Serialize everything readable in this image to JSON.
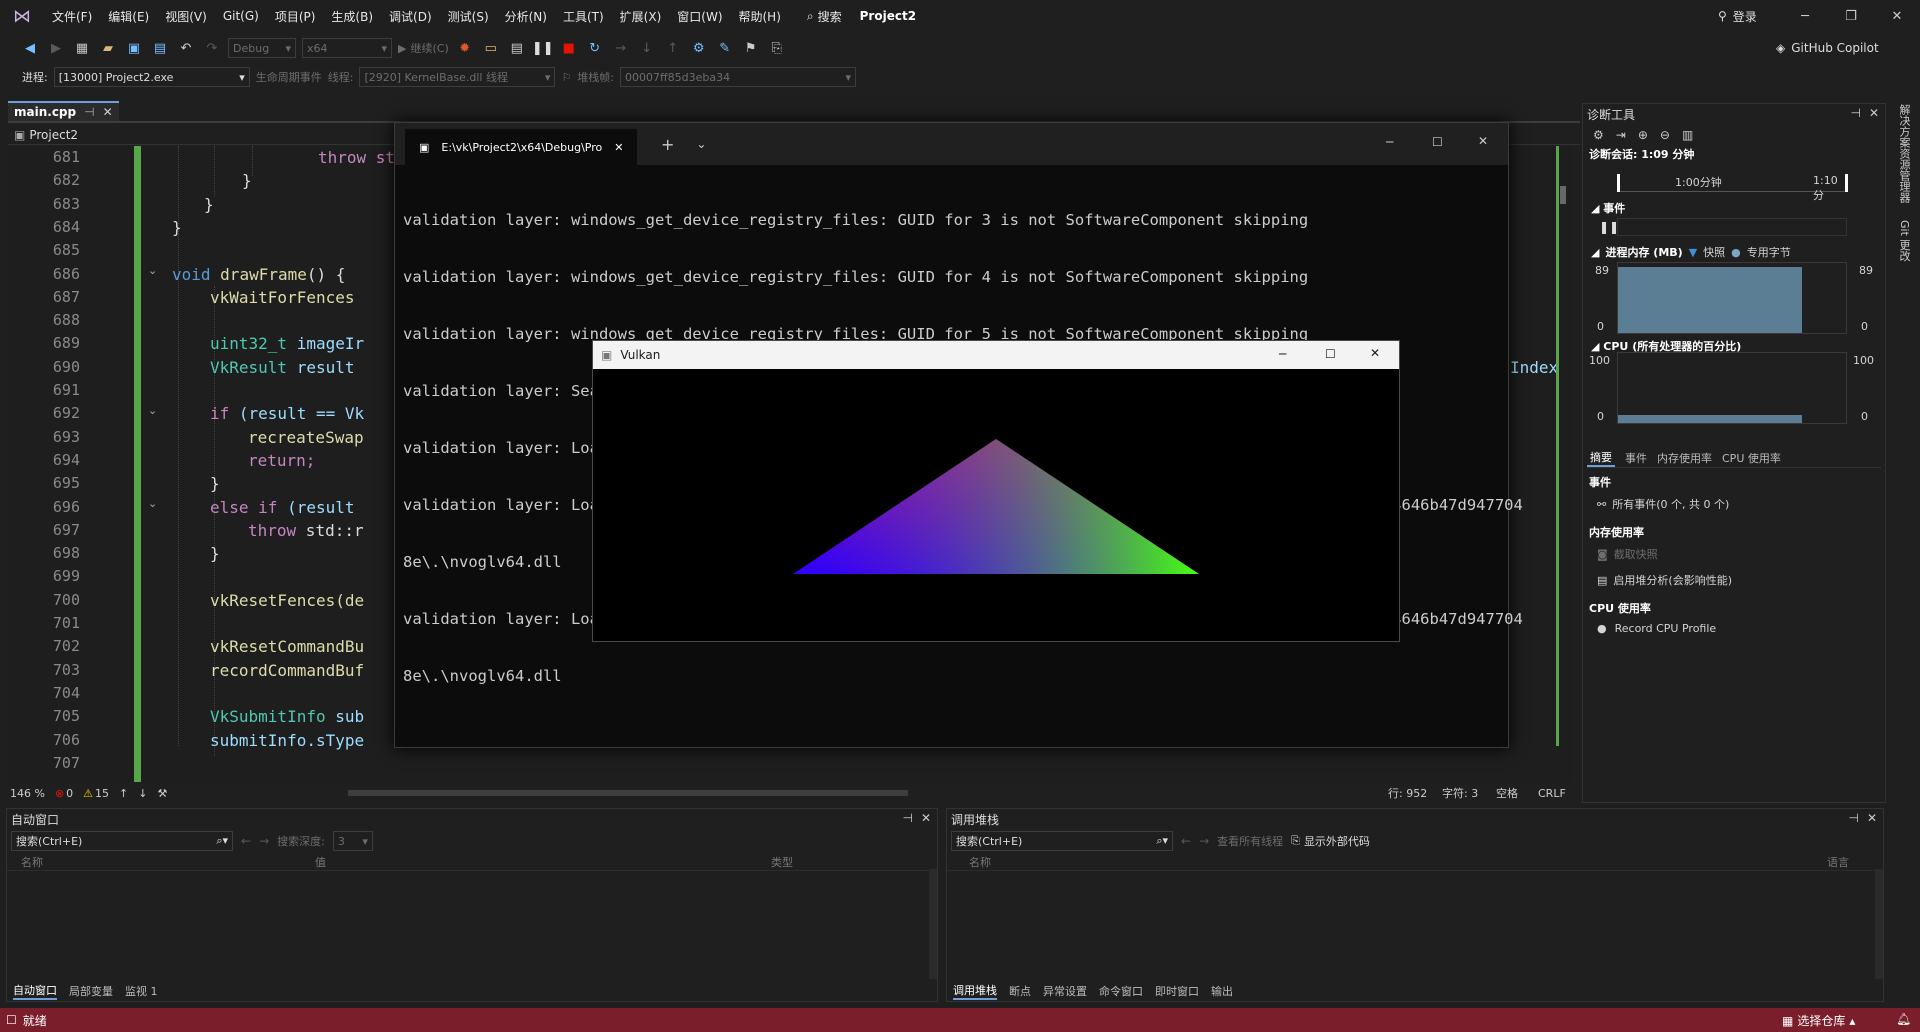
{
  "menu": {
    "items": [
      "文件(F)",
      "编辑(E)",
      "视图(V)",
      "Git(G)",
      "项目(P)",
      "生成(B)",
      "调试(D)",
      "测试(S)",
      "分析(N)",
      "工具(T)",
      "扩展(X)",
      "窗口(W)",
      "帮助(H)"
    ],
    "search": "搜索",
    "project_title": "Project2",
    "login": "登录",
    "copilot": "GitHub Copilot"
  },
  "toolbar": {
    "config": "Debug",
    "platform": "x64",
    "continue": "继续(C)"
  },
  "debugbar": {
    "process_label": "进程:",
    "process_value": "[13000] Project2.exe",
    "lifecycle": "生命周期事件",
    "thread_label": "线程:",
    "thread_value": "[2920] KernelBase.dll 线程",
    "stack_label": "堆栈帧:",
    "stack_value": "00007ff85d3eba34"
  },
  "editor": {
    "tab": "main.cpp",
    "nav_project": "Project2",
    "line_numbers": [
      "681",
      "682",
      "683",
      "684",
      "685",
      "686",
      "687",
      "688",
      "689",
      "690",
      "691",
      "692",
      "693",
      "694",
      "695",
      "696",
      "697",
      "698",
      "699",
      "700",
      "701",
      "702",
      "703",
      "704",
      "705",
      "706",
      "707"
    ],
    "zoom": "146 %",
    "errors": "0",
    "warnings": "15",
    "position": "行: 952",
    "char": "字符: 3",
    "spaces": "空格",
    "eol": "CRLF",
    "right_clip": "Index"
  },
  "code": {
    "l681": "throw st",
    "l686_kw": "void",
    "l686_fn": "drawFrame",
    "l686_rest": "() {",
    "l687": "vkWaitForFences",
    "l689_ty": "uint32_t",
    "l689_rest": " imageIr",
    "l690_ty": "VkResult",
    "l690_rest": " result",
    "l692_kw": "if",
    "l692_rest": " (result == Vk",
    "l693": "recreateSwap",
    "l694": "return;",
    "l696_kw": "else if",
    "l696_rest": " (result",
    "l697_kw": "throw",
    "l697_rest": " std::r",
    "l700": "vkResetFences(de",
    "l702": "vkResetCommandBu",
    "l703": "recordCommandBuf",
    "l705_ty": "VkSubmitInfo",
    "l705_rest": " sub",
    "l706": "submitInfo.sType"
  },
  "console": {
    "tab_title": "E:\\vk\\Project2\\x64\\Debug\\Pro",
    "lines": [
      "validation layer: windows_get_device_registry_files: GUID for 3 is not SoftwareComponent skipping",
      "validation layer: windows_get_device_registry_files: GUID for 4 is not SoftwareComponent skipping",
      "validation layer: windows_get_device_registry_files: GUID for 5 is not SoftwareComponent skipping",
      "validation layer: Searching for ICD drivers named .\\nvoglv64.dll",
      "validation layer: Loading layer library D:\\VulkanSDK\\1.4.335.0\\Bin\\.\\VkLayer_khronos_validation.dll",
      "validation layer: Loading layer library C:\\WINDOWS\\System32\\DriverStore\\FileRepository\\nv_dispi.inf_amd64_4646b47d947704",
      "8e\\.\\nvoglv64.dll",
      "validation layer: Loading layer library C:\\WINDOWS\\System32\\DriverStore\\FileRepository\\nv_dispi.inf_amd64_4646b47d947704",
      "8e\\.\\nvoglv64.dll"
    ]
  },
  "vulkan": {
    "title": "Vulkan"
  },
  "autos": {
    "title": "自动窗口",
    "search": "搜索(Ctrl+E)",
    "depth_label": "搜索深度:",
    "depth_value": "3",
    "col_name": "名称",
    "col_value": "值",
    "col_type": "类型",
    "tabs": [
      "自动窗口",
      "局部变量",
      "监视 1"
    ]
  },
  "callstack": {
    "title": "调用堆栈",
    "search": "搜索(Ctrl+E)",
    "all_threads": "查看所有线程",
    "external": "显示外部代码",
    "col_name": "名称",
    "col_lang": "语言",
    "tabs": [
      "调用堆栈",
      "断点",
      "异常设置",
      "命令窗口",
      "即时窗口",
      "输出"
    ]
  },
  "diag": {
    "title": "诊断工具",
    "session": "诊断会话: 1:09 分钟",
    "t1": "1:00分钟",
    "t2": "1:10分",
    "events": "事件",
    "mem_title": "进程内存 (MB)",
    "snapshot": "快照",
    "private": "专用字节",
    "mem_max": "89",
    "mem_min": "0",
    "cpu_title": "CPU (所有处理器的百分比)",
    "cpu_max": "100",
    "cpu_min": "0",
    "tabs": [
      "摘要",
      "事件",
      "内存使用率",
      "CPU 使用率"
    ],
    "sec_events": "事件",
    "all_events": "所有事件(0 个, 共 0 个)",
    "sec_mem": "内存使用率",
    "take_snapshot": "截取快照",
    "heap": "启用堆分析(会影响性能)",
    "sec_cpu": "CPU 使用率",
    "record_cpu": "Record CPU Profile"
  },
  "side": {
    "a": "解决方案资源管理器",
    "b": "Git 更改"
  },
  "status": {
    "ready": "就绪",
    "repo": "选择仓库"
  }
}
